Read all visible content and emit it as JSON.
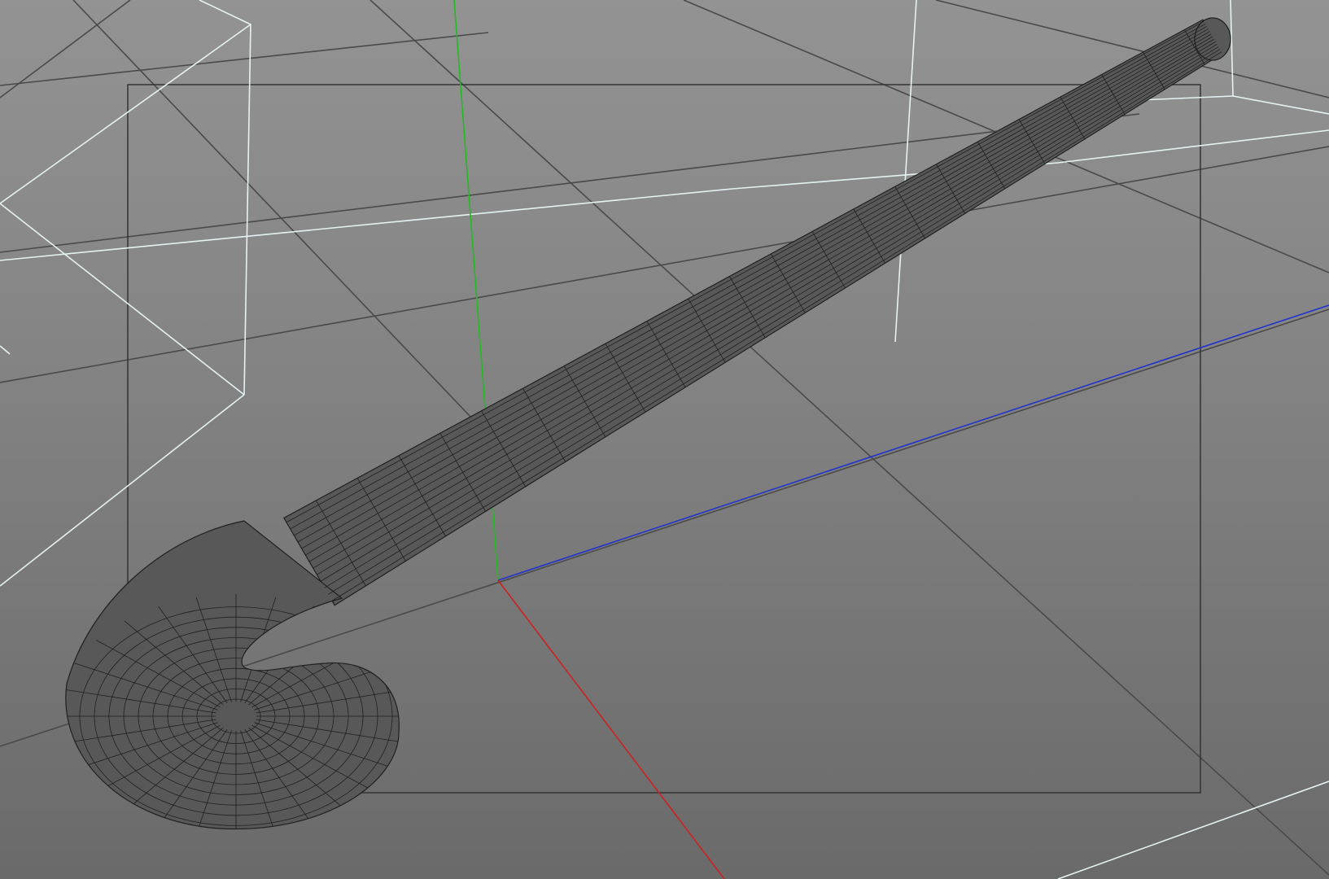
{
  "viewport": {
    "mode": "perspective",
    "display": "wireframe-on-shaded"
  },
  "colors": {
    "background_top": "#939393",
    "background_bottom": "#6a6a6a",
    "grid_line": "#4a4a4a",
    "resolution_gate": "#333333",
    "light_bounds": "#e6f2f2",
    "axis_x": "#cc2222",
    "axis_y": "#22bb22",
    "axis_z": "#2233cc",
    "mesh_fill": "#585858",
    "mesh_wire": "#202020"
  },
  "objects": [
    {
      "name": "hockey-stick",
      "type": "polygon-mesh"
    },
    {
      "name": "area-light-left",
      "type": "light-bounds"
    },
    {
      "name": "area-light-right",
      "type": "light-bounds"
    },
    {
      "name": "resolution-gate",
      "type": "camera-gate"
    },
    {
      "name": "world-origin-axes",
      "type": "axis-gizmo"
    }
  ]
}
